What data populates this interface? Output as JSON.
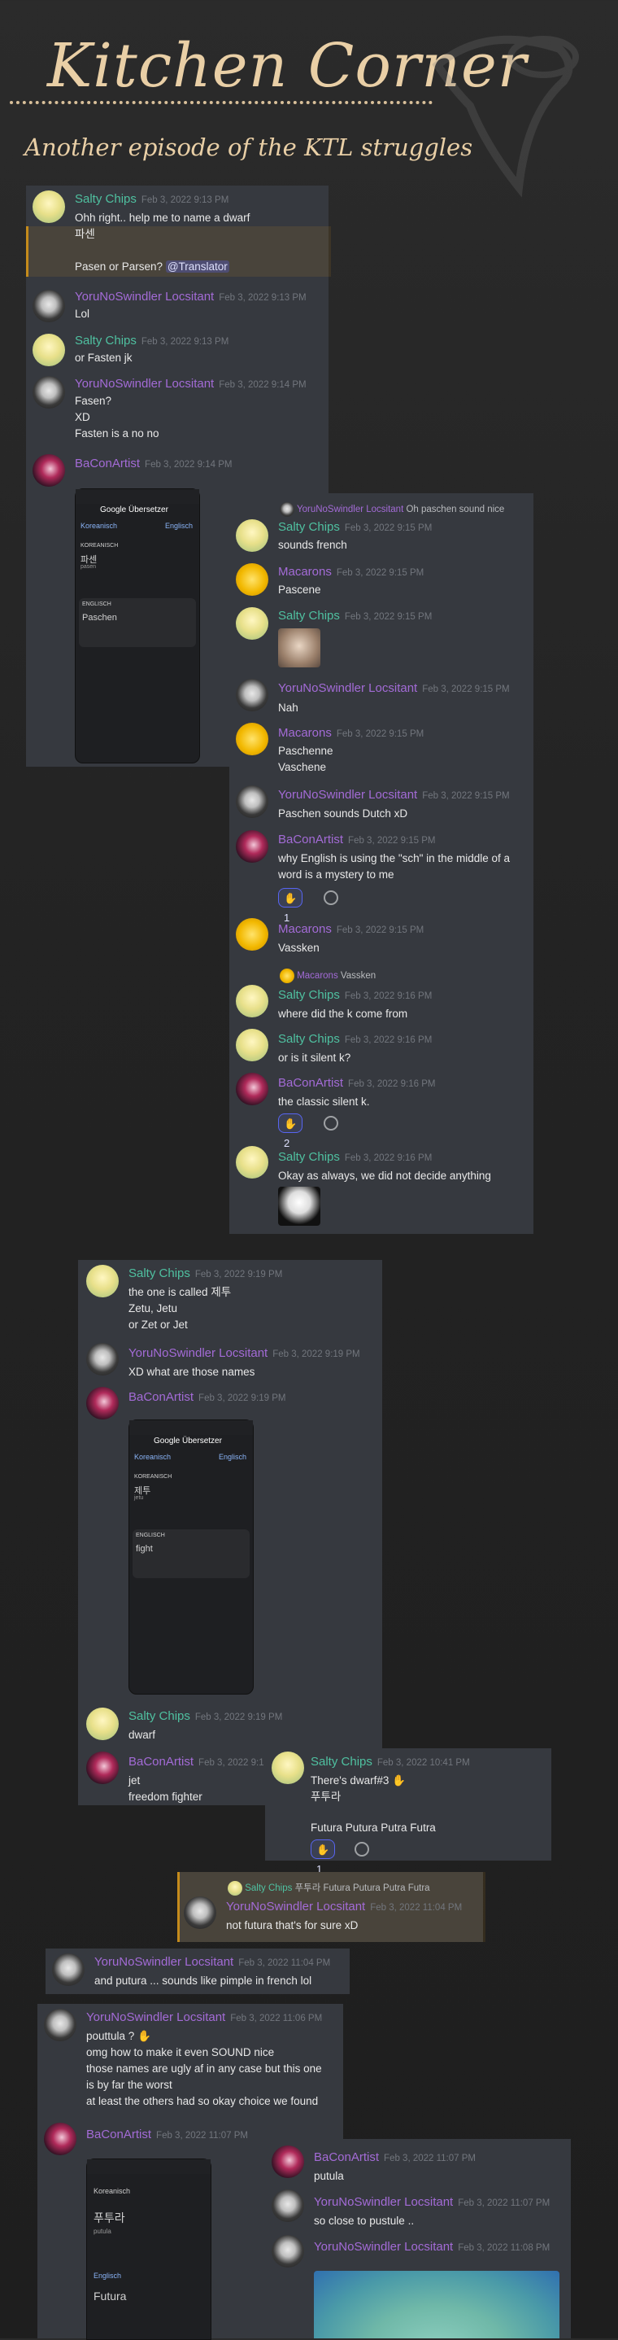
{
  "header": {
    "title": "Kitchen Corner",
    "subtitle": "Another episode of the KTL struggles"
  },
  "colors": {
    "accent_title": "#e9cfa6",
    "card_bg": "#36393f",
    "mention": "#5865f2"
  },
  "cardA": {
    "m1": {
      "author": "Salty Chips",
      "ts": "Feb 3, 2022 9:13 PM",
      "l1": "Ohh right.. help me to name a dwarf",
      "l2": "파센",
      "l3": "Pasen or Parsen? ",
      "mention": "@Translator"
    },
    "m2": {
      "author": "YoruNoSwindler Locsitant",
      "ts": "Feb 3, 2022 9:13 PM",
      "l1": "Lol"
    },
    "m3": {
      "author": "Salty Chips",
      "ts": "Feb 3, 2022 9:13 PM",
      "l1": "or Fasten jk"
    },
    "m4": {
      "author": "YoruNoSwindler Locsitant",
      "ts": "Feb 3, 2022 9:14 PM",
      "l1": "Fasen?",
      "l2": "XD",
      "l3": "Fasten is a no no"
    },
    "m5": {
      "author": "BaConArtist",
      "ts": "Feb 3, 2022 9:14 PM"
    },
    "phone": {
      "app": "Google Übersetzer",
      "from": "Koreanisch",
      "to": "Englisch",
      "src_lang": "KOREANISCH",
      "src": "파센",
      "roman": "pasen",
      "tgt_lang": "ENGLISCH",
      "tgt": "Paschen"
    }
  },
  "cardB": {
    "r1": {
      "author": "YoruNoSwindler Locsitant",
      "text": "Oh paschen sound nice"
    },
    "m1": {
      "author": "Salty Chips",
      "ts": "Feb 3, 2022 9:15 PM",
      "l1": "sounds french"
    },
    "m2": {
      "author": "Macarons",
      "ts": "Feb 3, 2022 9:15 PM",
      "l1": "Pascene"
    },
    "m3": {
      "author": "Salty Chips",
      "ts": "Feb 3, 2022 9:15 PM"
    },
    "m4": {
      "author": "YoruNoSwindler Locsitant",
      "ts": "Feb 3, 2022 9:15 PM",
      "l1": "Nah"
    },
    "m5": {
      "author": "Macarons",
      "ts": "Feb 3, 2022 9:15 PM",
      "l1": "Paschenne",
      "l2": "Vaschene"
    },
    "m6": {
      "author": "YoruNoSwindler Locsitant",
      "ts": "Feb 3, 2022 9:15 PM",
      "l1": "Paschen sounds Dutch xD"
    },
    "m7": {
      "author": "BaConArtist",
      "ts": "Feb 3, 2022 9:15 PM",
      "l1": "why English is using the \"sch\" in the middle of a",
      "l2": "word is a mystery to me",
      "react": "1"
    },
    "m8": {
      "author": "Macarons",
      "ts": "Feb 3, 2022 9:15 PM",
      "l1": "Vassken"
    },
    "r2": {
      "author": "Macarons",
      "text": "Vassken"
    },
    "m9": {
      "author": "Salty Chips",
      "ts": "Feb 3, 2022 9:16 PM",
      "l1": "where did the k come from"
    },
    "m10": {
      "author": "Salty Chips",
      "ts": "Feb 3, 2022 9:16 PM",
      "l1": "or is it silent k?"
    },
    "m11": {
      "author": "BaConArtist",
      "ts": "Feb 3, 2022 9:16 PM",
      "l1": "the classic silent k.",
      "react": "2"
    },
    "m12": {
      "author": "Salty Chips",
      "ts": "Feb 3, 2022 9:16 PM",
      "l1": "Okay as always, we did not decide anything"
    }
  },
  "cardC": {
    "m1": {
      "author": "Salty Chips",
      "ts": "Feb 3, 2022 9:19 PM",
      "l1": "the one is called 제투",
      "l2": "Zetu, Jetu",
      "l3": "or Zet or Jet"
    },
    "m2": {
      "author": "YoruNoSwindler Locsitant",
      "ts": "Feb 3, 2022 9:19 PM",
      "l1": "XD what are those names"
    },
    "m3": {
      "author": "BaConArtist",
      "ts": "Feb 3, 2022 9:19 PM"
    },
    "phone": {
      "app": "Google Übersetzer",
      "from": "Koreanisch",
      "to": "Englisch",
      "src_lang": "KOREANISCH",
      "src": "제투",
      "roman": "jetu",
      "tgt_lang": "ENGLISCH",
      "tgt": "fight"
    },
    "m4": {
      "author": "Salty Chips",
      "ts": "Feb 3, 2022 9:19 PM",
      "l1": "dwarf"
    },
    "m5": {
      "author": "BaConArtist",
      "ts": "Feb 3, 2022 9:1",
      "l1": "jet",
      "l2": "freedom fighter"
    }
  },
  "cardD": {
    "m1": {
      "author": "Salty Chips",
      "ts": "Feb 3, 2022 10:41 PM",
      "l1": "There's dwarf#3",
      "l2": "푸투라",
      "l3": "Futura Putura Putra Futra",
      "react": "1"
    }
  },
  "cardE": {
    "r1": {
      "author": "Salty Chips",
      "text": "푸투라  Futura Putura Putra Futra"
    },
    "m1": {
      "author": "YoruNoSwindler Locsitant",
      "ts": "Feb 3, 2022 11:04 PM",
      "l1": "not futura that's for sure xD"
    }
  },
  "cardF": {
    "m1": {
      "author": "YoruNoSwindler Locsitant",
      "ts": "Feb 3, 2022 11:04 PM",
      "l1": "and putura ... sounds like pimple in french lol"
    }
  },
  "cardG": {
    "m1": {
      "author": "YoruNoSwindler Locsitant",
      "ts": "Feb 3, 2022 11:06 PM",
      "l1": "pouttula ? ",
      "l2": "omg how to make it even SOUND nice",
      "l3": "those names are ugly af in any case but this one",
      "l4": "is by far the worst",
      "l5": "at least the others had so okay choice we found"
    },
    "m2": {
      "author": "BaConArtist",
      "ts": "Feb 3, 2022 11:07 PM"
    },
    "phone": {
      "from": "Koreanisch",
      "src": "푸투라",
      "roman": "putula",
      "tgt_lang": "Englisch",
      "tgt": "Futura"
    }
  },
  "cardH": {
    "m1": {
      "author": "BaConArtist",
      "ts": "Feb 3, 2022 11:07 PM",
      "l1": "putula"
    },
    "m2": {
      "author": "YoruNoSwindler Locsitant",
      "ts": "Feb 3, 2022 11:07 PM",
      "l1": "so close to pustule .."
    },
    "m3": {
      "author": "YoruNoSwindler Locsitant",
      "ts": "Feb 3, 2022 11:08 PM"
    }
  }
}
